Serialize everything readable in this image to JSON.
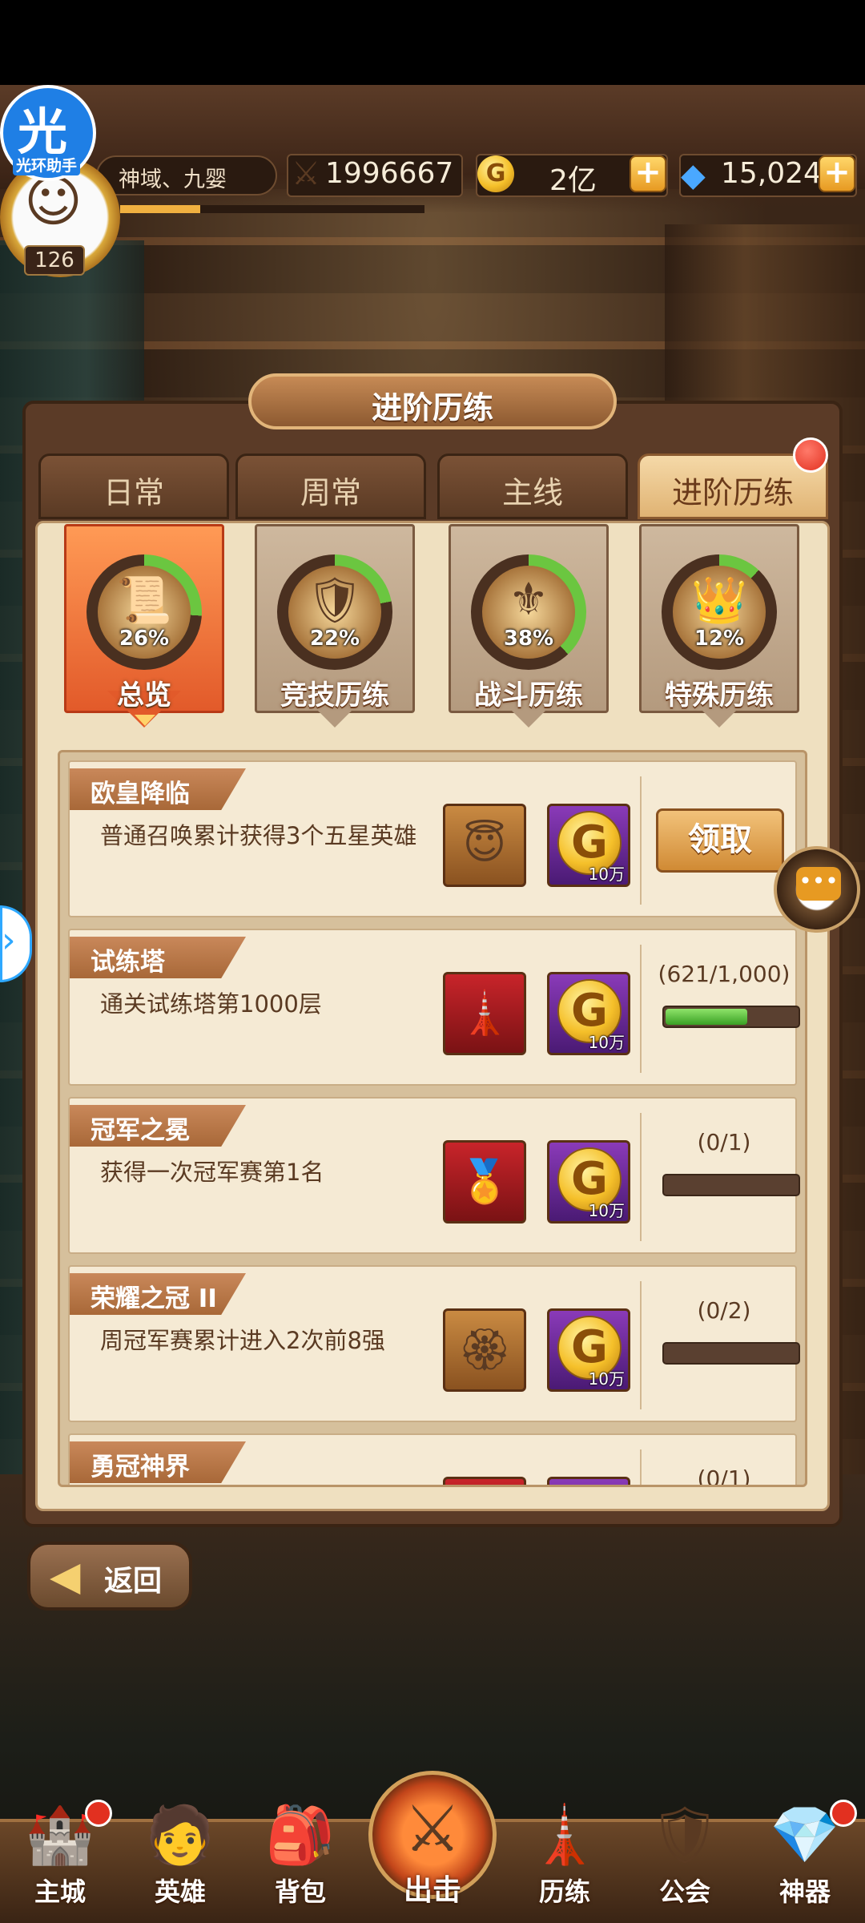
{
  "overlay": {
    "logo_char": "光",
    "logo_text": "光环助手"
  },
  "player": {
    "name": "神域、九婴",
    "level": "126",
    "power": "1996667",
    "gold": "2亿",
    "gems": "15,024"
  },
  "panel": {
    "title": "进阶历练"
  },
  "tabs": [
    {
      "label": "日常",
      "active": false
    },
    {
      "label": "周常",
      "active": false
    },
    {
      "label": "主线",
      "active": false
    },
    {
      "label": "进阶历练",
      "active": true,
      "badge": true
    }
  ],
  "categories": [
    {
      "name": "总览",
      "percent": "26%",
      "progress": 0.26,
      "icon": "scroll-icon",
      "active": true
    },
    {
      "name": "竞技历练",
      "percent": "22%",
      "progress": 0.22,
      "icon": "sword-shield-icon",
      "active": false
    },
    {
      "name": "战斗历练",
      "percent": "38%",
      "progress": 0.38,
      "icon": "winged-shield-icon",
      "active": false
    },
    {
      "name": "特殊历练",
      "percent": "12%",
      "progress": 0.12,
      "icon": "crown-icon",
      "active": false
    }
  ],
  "tasks": [
    {
      "title": "欧皇降临",
      "description": "普通召唤累计获得3个五星英雄",
      "rewards": [
        {
          "type": "hero-avatar",
          "color": "orange"
        },
        {
          "type": "gold",
          "color": "purple",
          "qty": "10万"
        }
      ],
      "action": "领取"
    },
    {
      "title": "试练塔",
      "description": "通关试练塔第1000层",
      "rewards": [
        {
          "type": "tower-badge",
          "color": "red"
        },
        {
          "type": "gold",
          "color": "purple",
          "qty": "10万"
        }
      ],
      "progress_text": "(621/1,000)",
      "progress": 0.621
    },
    {
      "title": "冠军之冕",
      "description": "获得一次冠军赛第1名",
      "rewards": [
        {
          "type": "champion-emblem",
          "color": "red"
        },
        {
          "type": "gold",
          "color": "purple",
          "qty": "10万"
        }
      ],
      "progress_text": "(0/1)",
      "progress": 0
    },
    {
      "title": "荣耀之冠 II",
      "description": "周冠军赛累计进入2次前8强",
      "rewards": [
        {
          "type": "laurel-emblem",
          "color": "orange"
        },
        {
          "type": "gold",
          "color": "purple",
          "qty": "10万"
        }
      ],
      "progress_text": "(0/2)",
      "progress": 0
    },
    {
      "title": "勇冠神界",
      "description": "",
      "rewards": [
        {
          "type": "unknown",
          "color": "red"
        },
        {
          "type": "gold",
          "color": "purple"
        }
      ],
      "progress_text": "(0/1)"
    }
  ],
  "back": {
    "label": "返回"
  },
  "nav": [
    {
      "label": "主城",
      "badge": true
    },
    {
      "label": "英雄",
      "badge": false
    },
    {
      "label": "背包",
      "badge": false
    },
    {
      "label": "出击",
      "badge": false
    },
    {
      "label": "历练",
      "badge": false
    },
    {
      "label": "公会",
      "badge": false
    },
    {
      "label": "神器",
      "badge": true
    }
  ],
  "colors": {
    "accent_orange": "#e25a2a",
    "progress_green": "#3aa024",
    "panel_brown": "#5b3b27",
    "parchment": "#efe0c0"
  }
}
